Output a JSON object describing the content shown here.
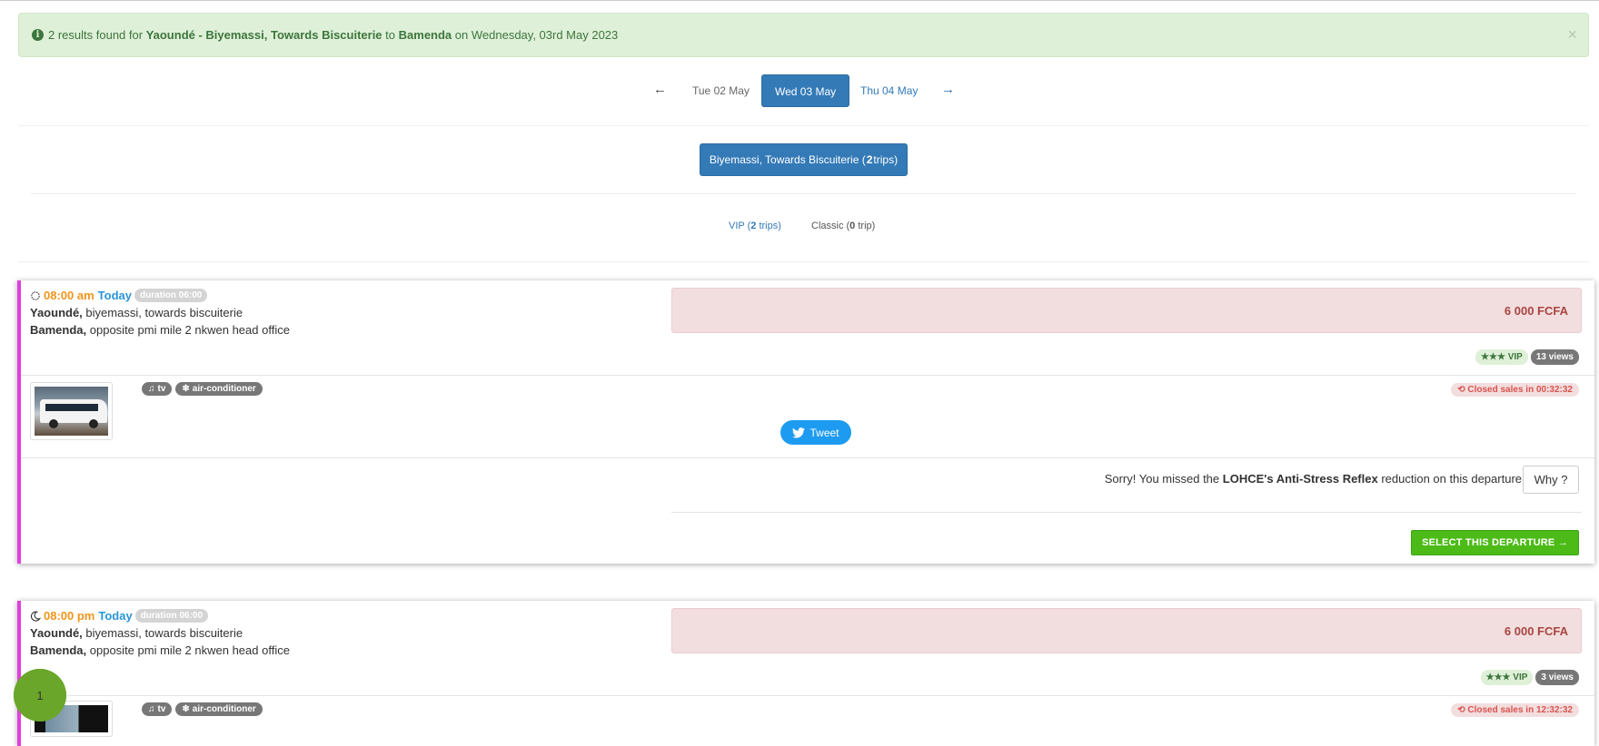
{
  "alert": {
    "count_text": "2 results found for",
    "origin": "Yaoundé - Biyemassi, Towards Biscuiterie",
    "to_word": "to",
    "destination": "Bamenda",
    "on_text": "on Wednesday, 03rd May 2023",
    "close": "×"
  },
  "date_nav": {
    "prev_day": "Tue 02 May",
    "current_day": "Wed 03 May",
    "next_day": "Thu 04 May",
    "prev_arrow": "←",
    "next_arrow": "→"
  },
  "stop": {
    "label": "Biyemassi, Towards Biscuiterie (",
    "count": "2",
    "suffix": " trips)"
  },
  "classes": {
    "vip": {
      "label": "VIP (",
      "count": "2",
      "suffix": " trips)"
    },
    "classic": {
      "label": "Classic (",
      "count": "0",
      "suffix": " trip)"
    }
  },
  "trips": [
    {
      "time": "08:00 am",
      "day": "Today",
      "duration": "duration 06:00",
      "icon": "sun-icon",
      "from_city": "Yaoundé,",
      "from_detail": "biyemassi, towards biscuiterie",
      "to_city": "Bamenda,",
      "to_detail": "opposite pmi mile 2 nkwen head office",
      "price": "6 000 FCFA",
      "class_badge": "★★★ VIP",
      "views": "13 views",
      "amenities": [
        "tv",
        "air-conditioner"
      ],
      "closed": "Closed sales in 00:32:32",
      "tweet": "Tweet",
      "missed_pre": "Sorry! You missed the",
      "missed_bold": "LOHCE's Anti-Stress Reflex",
      "missed_post": "reduction on this departure",
      "why": "Why ?",
      "select": "SELECT THIS DEPARTURE →"
    },
    {
      "time": "08:00 pm",
      "day": "Today",
      "duration": "duration 06:00",
      "icon": "moon-icon",
      "from_city": "Yaoundé,",
      "from_detail": "biyemassi, towards biscuiterie",
      "to_city": "Bamenda,",
      "to_detail": "opposite pmi mile 2 nkwen head office",
      "price": "6 000 FCFA",
      "class_badge": "★★★ VIP",
      "views": "3 views",
      "amenities": [
        "tv",
        "air-conditioner"
      ],
      "closed": "Closed sales in 12:32:32"
    }
  ],
  "chat": {
    "unread": "1"
  },
  "colors": {
    "accent": "#337ab7",
    "card_border": "#e040dc",
    "select_green": "#4cbb17",
    "price_bg": "#f2dede"
  }
}
